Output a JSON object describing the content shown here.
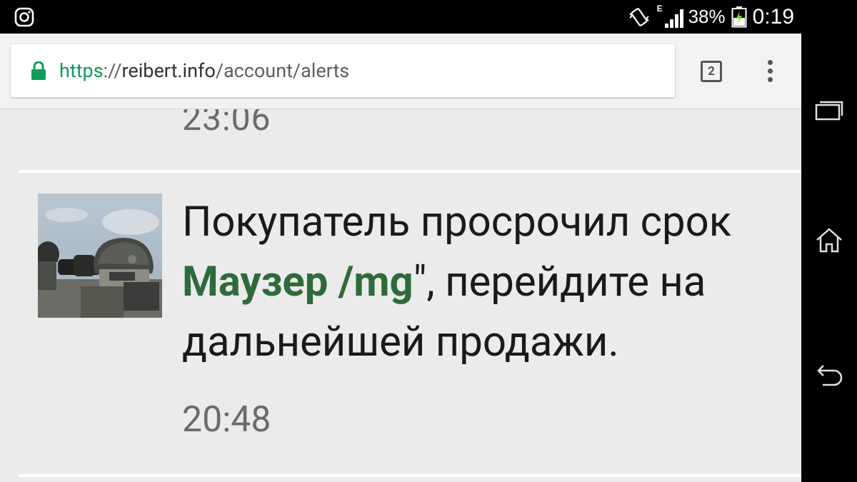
{
  "status_bar": {
    "network_type": "E",
    "battery_percent": "38%",
    "clock": "0:19",
    "icons": [
      "instagram-icon",
      "vibrate-icon",
      "signal-icon",
      "battery-charging-icon"
    ]
  },
  "browser": {
    "url_scheme": "https",
    "url_sep": "://",
    "url_host": "reibert.info",
    "url_path": "/account/alerts",
    "tab_count": "2"
  },
  "alerts": {
    "previous_time": "23:06",
    "item": {
      "line1": "Покупатель просрочил срок",
      "line2_prefix": "",
      "line2_link": "Маузер /mg",
      "line2_suffix": "\", перейдите на",
      "line3": "дальнейшей продажи.",
      "time": "20:48"
    }
  },
  "colors": {
    "accent_green": "#0f9d58",
    "link_green": "#2f6b3a",
    "background": "#ebebeb"
  }
}
